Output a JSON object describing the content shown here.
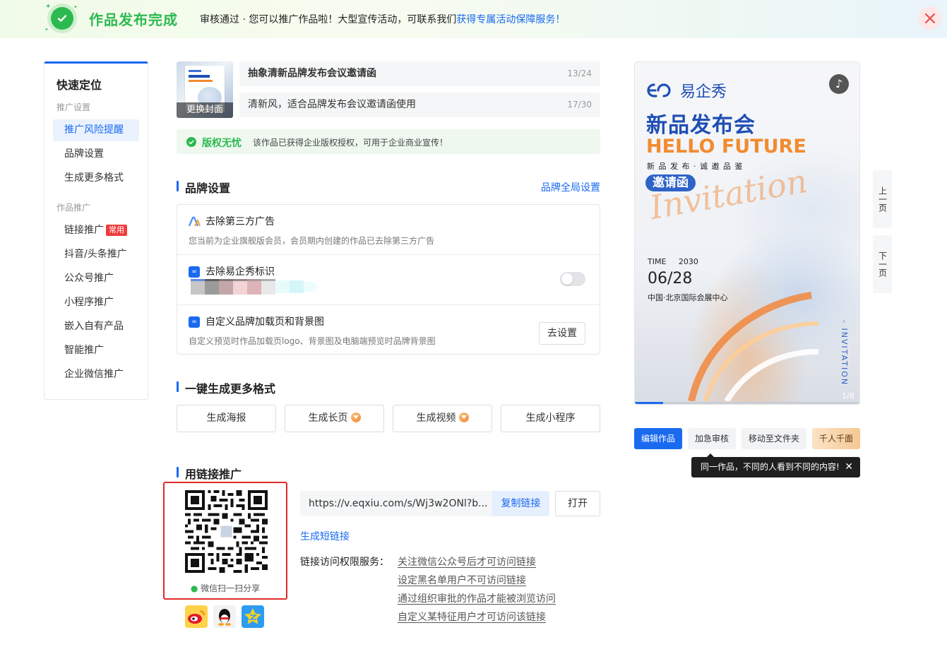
{
  "banner": {
    "title": "作品发布完成",
    "message": "审核通过 · 您可以推广作品啦！大型宣传活动，可联系我们",
    "message_link": "获得专属活动保障服务！"
  },
  "nav": {
    "title": "快速定位",
    "group1": "推广设置",
    "group1_items": [
      "推广风险提醒",
      "品牌设置",
      "生成更多格式"
    ],
    "group2": "作品推广",
    "group2_items": [
      "链接推广",
      "抖音/头条推广",
      "公众号推广",
      "小程序推广",
      "嵌入自有产品",
      "智能推广",
      "企业微信推广"
    ],
    "hot_tag": "常用"
  },
  "work": {
    "cover_button": "更换封面",
    "title_value": "抽象清新品牌发布会议邀请函",
    "title_count": "13/24",
    "desc_value": "清新风，适合品牌发布会议邀请函使用",
    "desc_count": "17/30",
    "copyright_label": "版权无忧",
    "copyright_text": "该作品已获得企业版权授权，可用于企业商业宣传！"
  },
  "brand": {
    "section_title": "品牌设置",
    "global_link": "品牌全局设置",
    "rows": [
      {
        "title": "去除第三方广告",
        "desc": "您当前为企业旗舰版会员，会员期内创建的作品已去除第三方广告"
      },
      {
        "title": "去除易企秀标识",
        "desc": ""
      },
      {
        "title": "自定义品牌加载页和背景图",
        "desc": "自定义预览时作品加载页logo、背景图及电脑端预览时品牌背景图",
        "button": "去设置"
      }
    ]
  },
  "formats": {
    "section_title": "一键生成更多格式",
    "buttons": [
      "生成海报",
      "生成长页",
      "生成视频",
      "生成小程序"
    ]
  },
  "link": {
    "section_title": "用链接推广",
    "qr_caption": "微信扫一扫分享",
    "url": "https://v.eqxiu.com/s/Wj3w2ONl?b...",
    "copy_label": "复制链接",
    "open_label": "打开",
    "short_link": "生成短链接",
    "access_label": "链接访问权限服务：",
    "access_items": [
      "关注微信公众号后才可访问链接",
      "设定黑名单用户不可访问链接",
      "通过组织审批的作品才能被浏览访问",
      "自定义某特征用户才可访问该链接"
    ]
  },
  "preview": {
    "logo_text": "易企秀",
    "headline": "新品发布会",
    "hello": "HELLO FUTURE",
    "sub": "新 品 发 布 · 诚 邀 品 鉴",
    "invite": "邀请函",
    "script": "Invitation",
    "time_label": "TIME",
    "year": "2030",
    "date": "06/28",
    "venue": "中国·北京国际会展中心",
    "vertical": "- INVITATION",
    "page": "1/8",
    "prev": "上一页",
    "next": "下一页"
  },
  "actions": {
    "edit": "编辑作品",
    "urgent": "加急审核",
    "move": "移动至文件夹",
    "personalize": "千人千面",
    "tooltip": "同一作品，不同的人看到不同的内容!"
  },
  "colors": {
    "accent": "#1a6af0",
    "success": "#2cb94f",
    "danger": "#e02a2a"
  }
}
